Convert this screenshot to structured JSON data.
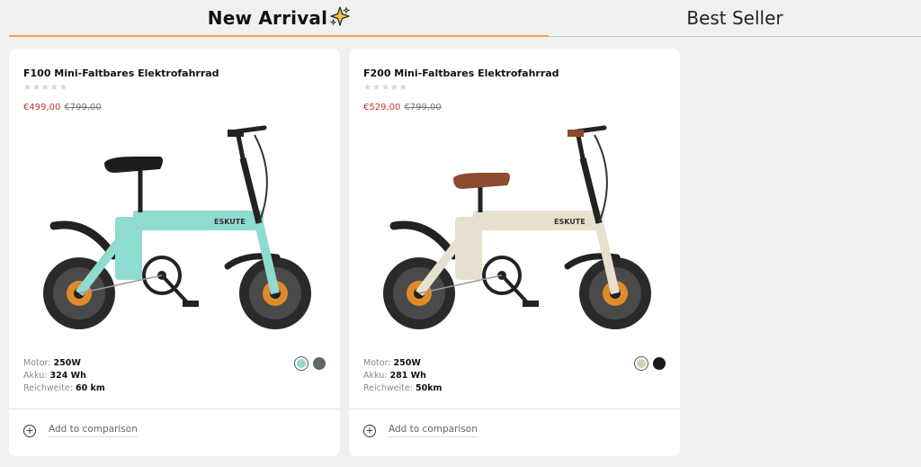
{
  "tabs": {
    "new_arrival": "New Arrival",
    "best_seller": "Best Seller"
  },
  "accent_color": "#f3a24a",
  "products": [
    {
      "title": "F100 Mini-Faltbares Elektrofahrrad",
      "stars": "★★★★★",
      "price_now": "€499,00",
      "price_old": "€799,00",
      "specs": [
        {
          "label": "Motor:",
          "value": "250W"
        },
        {
          "label": "Akku:",
          "value": "324 Wh"
        },
        {
          "label": "Reichweite:",
          "value": "60 km"
        }
      ],
      "colors": [
        "#8fdbd0",
        "#5d6b67"
      ],
      "brand_on_frame": "ESKUTE",
      "compare_label": "Add to comparison"
    },
    {
      "title": "F200 Mini-Faltbares Elektrofahrrad",
      "stars": "★★★★★",
      "price_now": "€529,00",
      "price_old": "€799,00",
      "specs": [
        {
          "label": "Motor:",
          "value": "250W"
        },
        {
          "label": "Akku:",
          "value": "281 Wh"
        },
        {
          "label": "Reichweite:",
          "value": "50km"
        }
      ],
      "colors": [
        "#d7cdbb",
        "#1a1a1a"
      ],
      "brand_on_frame": "ESKUTE",
      "compare_label": "Add to comparison"
    }
  ]
}
